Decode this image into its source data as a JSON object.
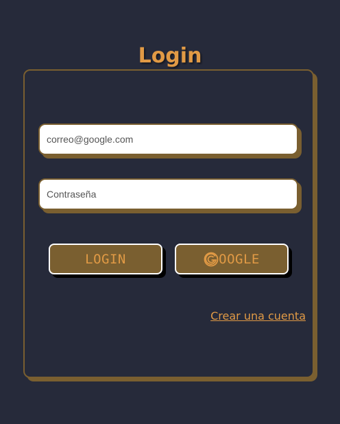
{
  "title": "Login",
  "email_field": {
    "value": "",
    "placeholder": "correo@google.com"
  },
  "password_field": {
    "value": "",
    "placeholder": "Contraseña"
  },
  "buttons": {
    "login_label": "LOGIN",
    "google_label": "OOGLE",
    "google_icon": "google-icon"
  },
  "register_link": "Crear una cuenta",
  "colors": {
    "background": "#262a3a",
    "accent": "#e19a45",
    "border": "#7a5f30",
    "button_bg": "#7a5f30"
  }
}
